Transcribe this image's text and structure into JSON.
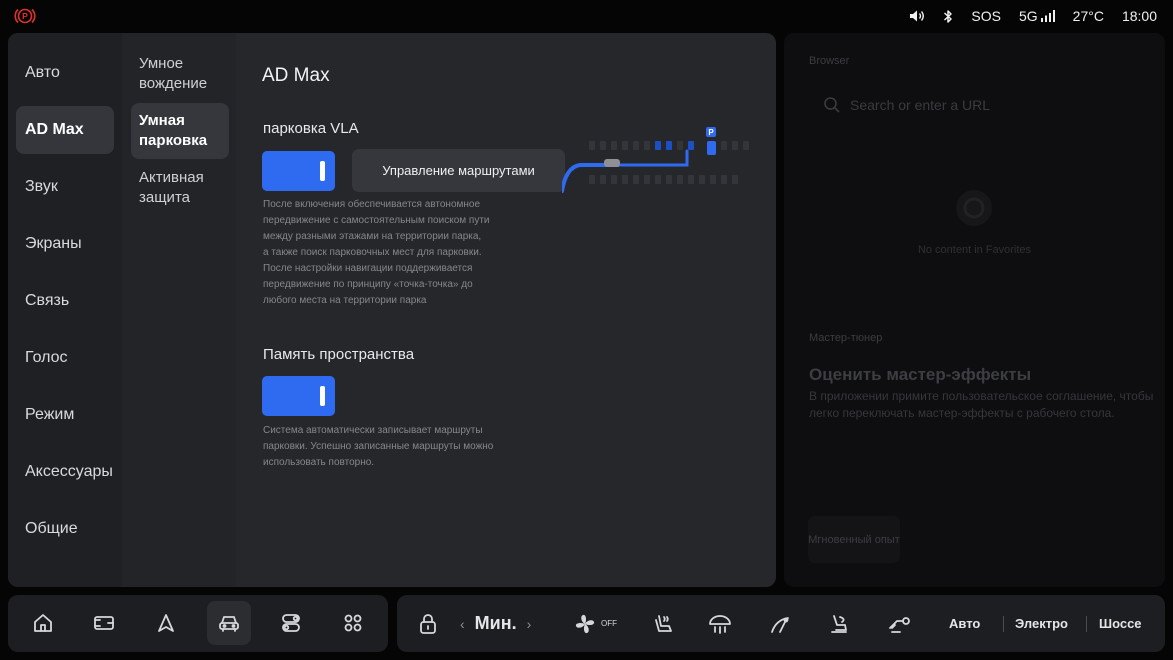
{
  "status": {
    "sos": "SOS",
    "network": "5G",
    "temperature": "27°C",
    "time": "18:00"
  },
  "nav1": {
    "items": [
      "Авто",
      "AD Max",
      "Звук",
      "Экраны",
      "Связь",
      "Голос",
      "Режим",
      "Аксессуары",
      "Общие"
    ],
    "active": "AD Max"
  },
  "nav2": {
    "items": [
      "Умное вождение",
      "Умная парковка",
      "Активная защита"
    ],
    "active": "Умная парковка"
  },
  "content": {
    "title": "AD Max",
    "vla": {
      "title": "парковка VLA",
      "enabled": true,
      "route_button": "Управление маршрутами",
      "description_lines": [
        "После включения обеспечивается автономное",
        "передвижение с самостоятельным поиском пути",
        "между разными этажами на территории парка,",
        "а также поиск парковочных мест для парковки.",
        "После настройки навигации поддерживается",
        "передвижение по принципу «точка-точка» до",
        "любого места на территории парка"
      ]
    },
    "memory": {
      "title": "Память пространства",
      "enabled": true,
      "description_lines": [
        "Система автоматически записывает маршруты",
        "парковки. Успешно записанные маршруты можно",
        "использовать повторно."
      ]
    }
  },
  "widgets": {
    "browser_label": "Browser",
    "search_placeholder": "Search or enter a URL",
    "empty_text": "No content in Favorites",
    "tuner_label": "Мастер-тюнер",
    "tuner_title": "Оценить мастер-эффекты",
    "tuner_text": "В приложении примите пользовательское соглашение, чтобы легко переключать мастер-эффекты с рабочего стола.",
    "quick_label": "Мгновенный опыт"
  },
  "dock": {
    "fan_label": "Мин.",
    "fan_state": "OFF",
    "drive_modes": [
      "Авто",
      "Электро",
      "Шоссе"
    ]
  },
  "colors": {
    "accent": "#2f6bf0",
    "panel": "#26272b",
    "brake_red": "#e0322b"
  },
  "icons": {
    "status": [
      "parking-brake-icon",
      "volume-icon",
      "bluetooth-icon",
      "signal-icon"
    ],
    "dock": [
      "home-icon",
      "wallet-icon",
      "navigation-icon",
      "car-icon",
      "toggle-icon",
      "apps-icon",
      "lock-icon",
      "fan-icon",
      "seat-heat-icon",
      "steering-heat-icon",
      "wiper-icon",
      "seat-vent-icon",
      "defrost-icon"
    ]
  }
}
